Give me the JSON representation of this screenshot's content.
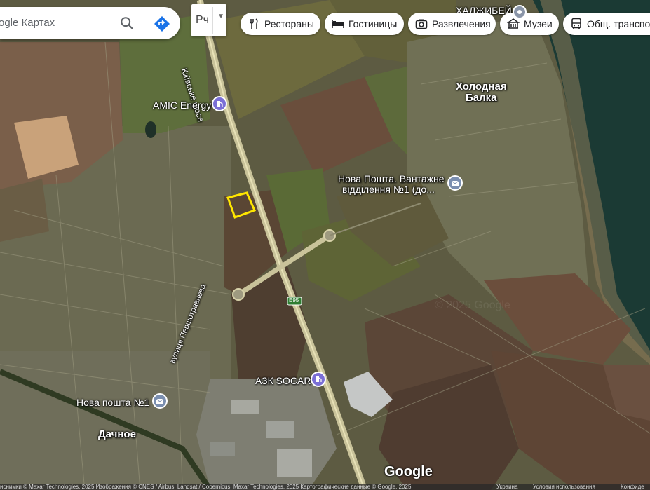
{
  "search": {
    "text": "ogle Картах"
  },
  "layer": {
    "label": "Рч"
  },
  "chips": [
    {
      "label": "Рестораны",
      "icon": "fork-knife-icon"
    },
    {
      "label": "Гостиницы",
      "icon": "bed-icon"
    },
    {
      "label": "Развлечения",
      "icon": "camera-icon"
    },
    {
      "label": "Музеи",
      "icon": "museum-icon"
    },
    {
      "label": "Общ. транспорт",
      "icon": "bus-icon"
    }
  ],
  "places": {
    "khalzhybei": "ХАЛЖИБЕЙ",
    "kholodna_balka_1": "Холодная",
    "kholodna_balka_2": "Балка",
    "amic": "AMIC Energy",
    "nova_poshta_cargo_1": "Нова Пошта. Вантажне",
    "nova_poshta_cargo_2": "відділення №1 (до...",
    "socar": "АЗК SOCAR",
    "nova_poshta_1": "Нова пошта №1",
    "dachnoe": "Дачное",
    "kyivske_shose": "Київське шосе",
    "pershotravneva": "вулиця Першотравнева",
    "e95": "E95"
  },
  "google_logo": "Google",
  "attribution": {
    "left": "иснимки © Maxar Technologies, 2025 Изображения © CNES / Airbus, Landsat / Copernicus, Maxar Technologies, 2025 Картографические данные © Google, 2025",
    "ukraine": "Украина",
    "terms": "Условия использования",
    "privacy": "Конфиде"
  },
  "colors": {
    "highlight_polygon": "#ffe600",
    "fuel_pin": "#7b6fd6",
    "post_pin": "#7b8fb0",
    "water": "#1b3a34"
  }
}
